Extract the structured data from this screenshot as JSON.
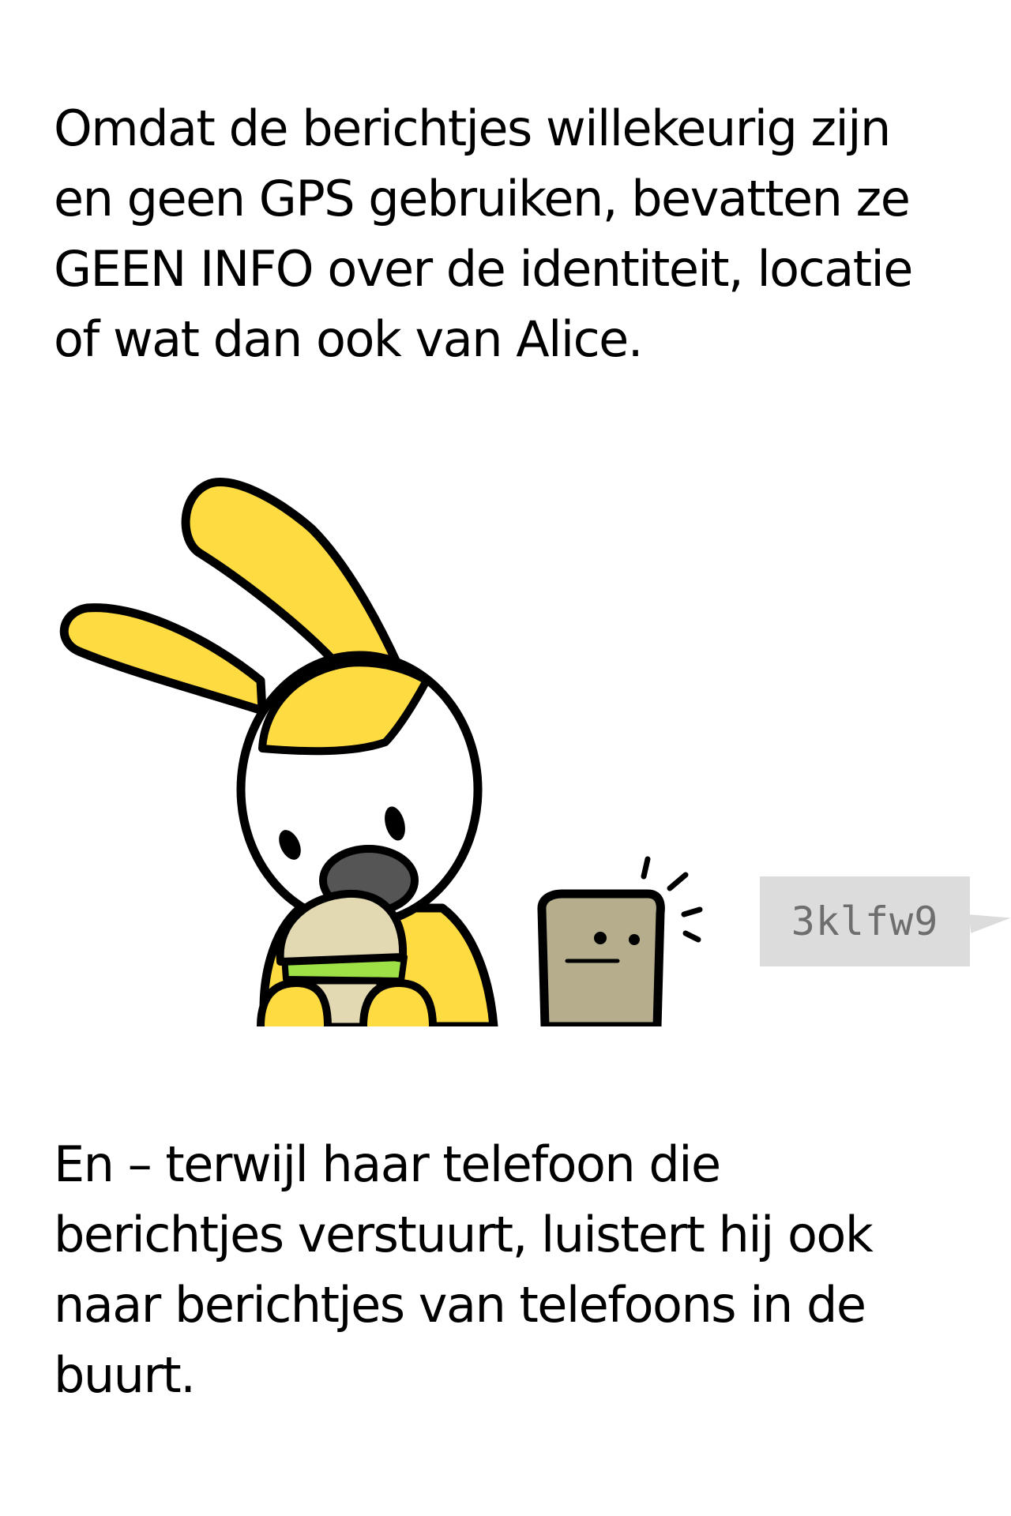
{
  "captions": {
    "top": "Omdat de berichtjes willekeurig zijn en geen GPS gebruiken, bevatten ze GEEN INFO over de identiteit, locatie of wat dan ook van Alice.",
    "bottom": "En – terwijl haar telefoon die berichtjes verstuurt, luistert hij ook naar berichtjes van telefoons in de buurt."
  },
  "message_bubble": {
    "text": "3klfw9"
  },
  "colors": {
    "rabbit_yellow": "#fedb41",
    "phone_tan": "#b5ad8c",
    "bun": "#e2d8b2",
    "lettuce": "#9de146",
    "nose_gray": "#555555",
    "bubble_gray": "#dcdcdc",
    "bubble_text": "#6e6e6e"
  }
}
